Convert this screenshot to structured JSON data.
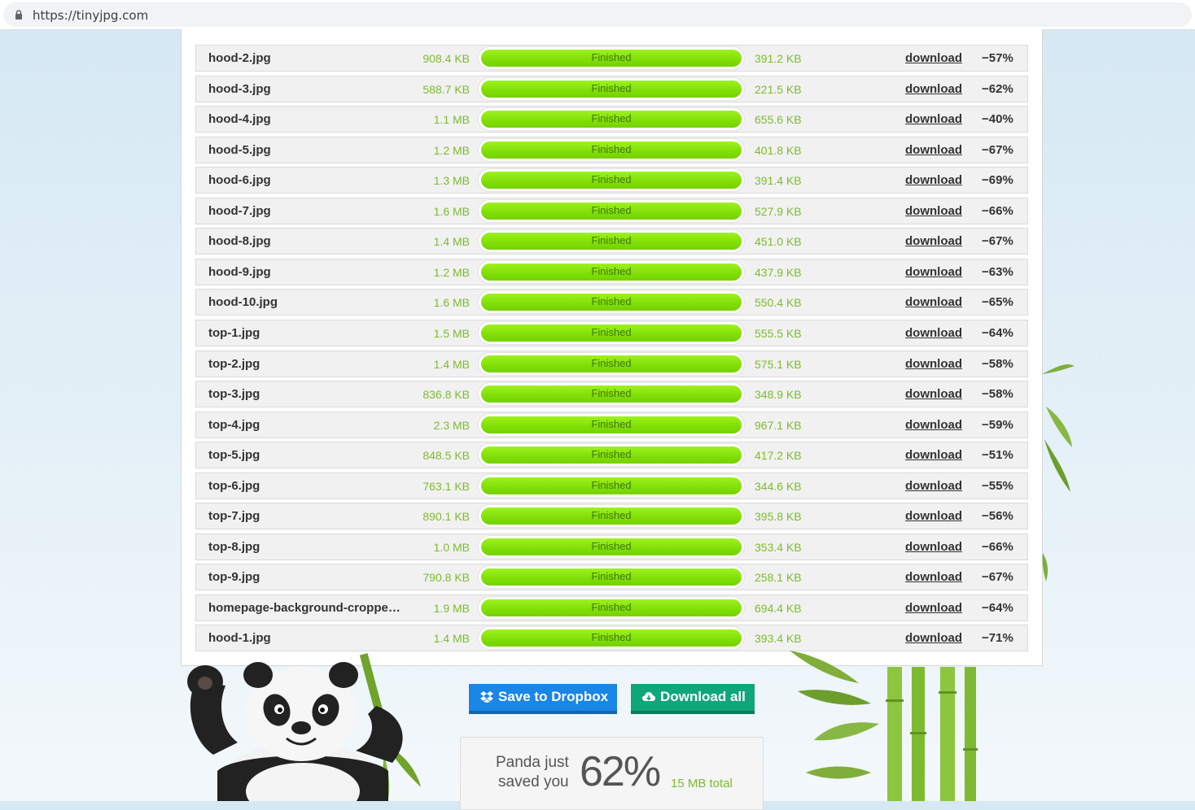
{
  "browser": {
    "url": "https://tinyjpg.com"
  },
  "files": [
    {
      "name": "hood-2.jpg",
      "original_size": "908.4 KB",
      "status": "Finished",
      "new_size": "391.2 KB",
      "action": "download",
      "saving": "−57%"
    },
    {
      "name": "hood-3.jpg",
      "original_size": "588.7 KB",
      "status": "Finished",
      "new_size": "221.5 KB",
      "action": "download",
      "saving": "−62%"
    },
    {
      "name": "hood-4.jpg",
      "original_size": "1.1 MB",
      "status": "Finished",
      "new_size": "655.6 KB",
      "action": "download",
      "saving": "−40%"
    },
    {
      "name": "hood-5.jpg",
      "original_size": "1.2 MB",
      "status": "Finished",
      "new_size": "401.8 KB",
      "action": "download",
      "saving": "−67%"
    },
    {
      "name": "hood-6.jpg",
      "original_size": "1.3 MB",
      "status": "Finished",
      "new_size": "391.4 KB",
      "action": "download",
      "saving": "−69%"
    },
    {
      "name": "hood-7.jpg",
      "original_size": "1.6 MB",
      "status": "Finished",
      "new_size": "527.9 KB",
      "action": "download",
      "saving": "−66%"
    },
    {
      "name": "hood-8.jpg",
      "original_size": "1.4 MB",
      "status": "Finished",
      "new_size": "451.0 KB",
      "action": "download",
      "saving": "−67%"
    },
    {
      "name": "hood-9.jpg",
      "original_size": "1.2 MB",
      "status": "Finished",
      "new_size": "437.9 KB",
      "action": "download",
      "saving": "−63%"
    },
    {
      "name": "hood-10.jpg",
      "original_size": "1.6 MB",
      "status": "Finished",
      "new_size": "550.4 KB",
      "action": "download",
      "saving": "−65%"
    },
    {
      "name": "top-1.jpg",
      "original_size": "1.5 MB",
      "status": "Finished",
      "new_size": "555.5 KB",
      "action": "download",
      "saving": "−64%"
    },
    {
      "name": "top-2.jpg",
      "original_size": "1.4 MB",
      "status": "Finished",
      "new_size": "575.1 KB",
      "action": "download",
      "saving": "−58%"
    },
    {
      "name": "top-3.jpg",
      "original_size": "836.8 KB",
      "status": "Finished",
      "new_size": "348.9 KB",
      "action": "download",
      "saving": "−58%"
    },
    {
      "name": "top-4.jpg",
      "original_size": "2.3 MB",
      "status": "Finished",
      "new_size": "967.1 KB",
      "action": "download",
      "saving": "−59%"
    },
    {
      "name": "top-5.jpg",
      "original_size": "848.5 KB",
      "status": "Finished",
      "new_size": "417.2 KB",
      "action": "download",
      "saving": "−51%"
    },
    {
      "name": "top-6.jpg",
      "original_size": "763.1 KB",
      "status": "Finished",
      "new_size": "344.6 KB",
      "action": "download",
      "saving": "−55%"
    },
    {
      "name": "top-7.jpg",
      "original_size": "890.1 KB",
      "status": "Finished",
      "new_size": "395.8 KB",
      "action": "download",
      "saving": "−56%"
    },
    {
      "name": "top-8.jpg",
      "original_size": "1.0 MB",
      "status": "Finished",
      "new_size": "353.4 KB",
      "action": "download",
      "saving": "−66%"
    },
    {
      "name": "top-9.jpg",
      "original_size": "790.8 KB",
      "status": "Finished",
      "new_size": "258.1 KB",
      "action": "download",
      "saving": "−67%"
    },
    {
      "name": "homepage-background-croppe…",
      "original_size": "1.9 MB",
      "status": "Finished",
      "new_size": "694.4 KB",
      "action": "download",
      "saving": "−64%"
    },
    {
      "name": "hood-1.jpg",
      "original_size": "1.4 MB",
      "status": "Finished",
      "new_size": "393.4 KB",
      "action": "download",
      "saving": "−71%"
    }
  ],
  "actions": {
    "dropbox_label": "Save to Dropbox",
    "download_all_label": "Download all"
  },
  "summary": {
    "line1": "Panda just",
    "line2": "saved you",
    "percent": "62%",
    "total": "15 MB total"
  },
  "colors": {
    "progress": "#82e008",
    "dropbox": "#1a86e5",
    "download_all": "#0fa67a",
    "size_text": "#7dbb2e"
  },
  "icons": {
    "lock": "lock-icon",
    "dropbox": "dropbox-icon",
    "download_all": "cloud-download-icon"
  }
}
